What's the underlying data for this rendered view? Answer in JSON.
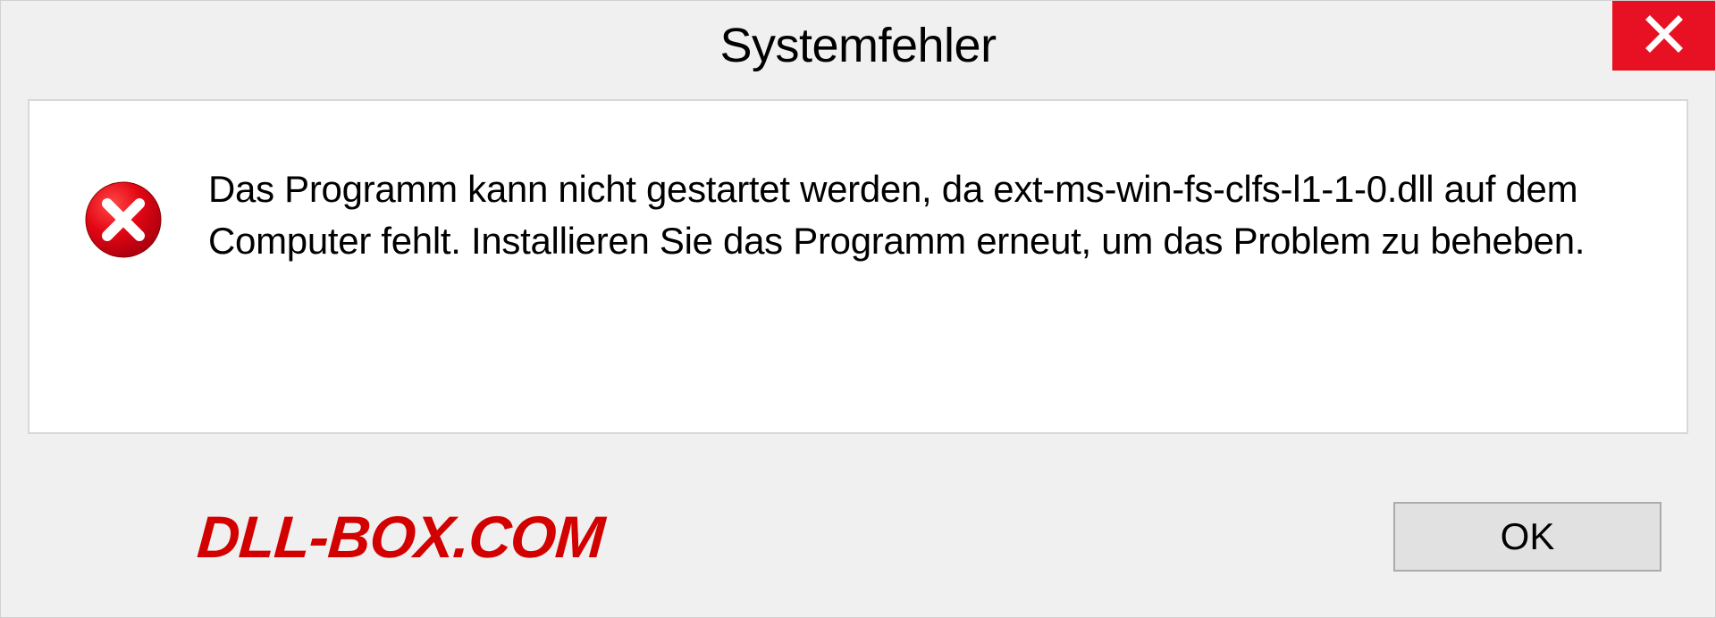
{
  "dialog": {
    "title": "Systemfehler",
    "message": "Das Programm kann nicht gestartet werden, da ext-ms-win-fs-clfs-l1-1-0.dll auf dem Computer fehlt. Installieren Sie das Programm erneut, um das Problem zu beheben.",
    "ok_label": "OK"
  },
  "watermark": {
    "text": "DLL-BOX.COM"
  },
  "icons": {
    "close": "close-icon",
    "error": "error-icon"
  },
  "colors": {
    "close_bg": "#e81123",
    "error_circle": "#e30613",
    "watermark": "#d30000"
  }
}
